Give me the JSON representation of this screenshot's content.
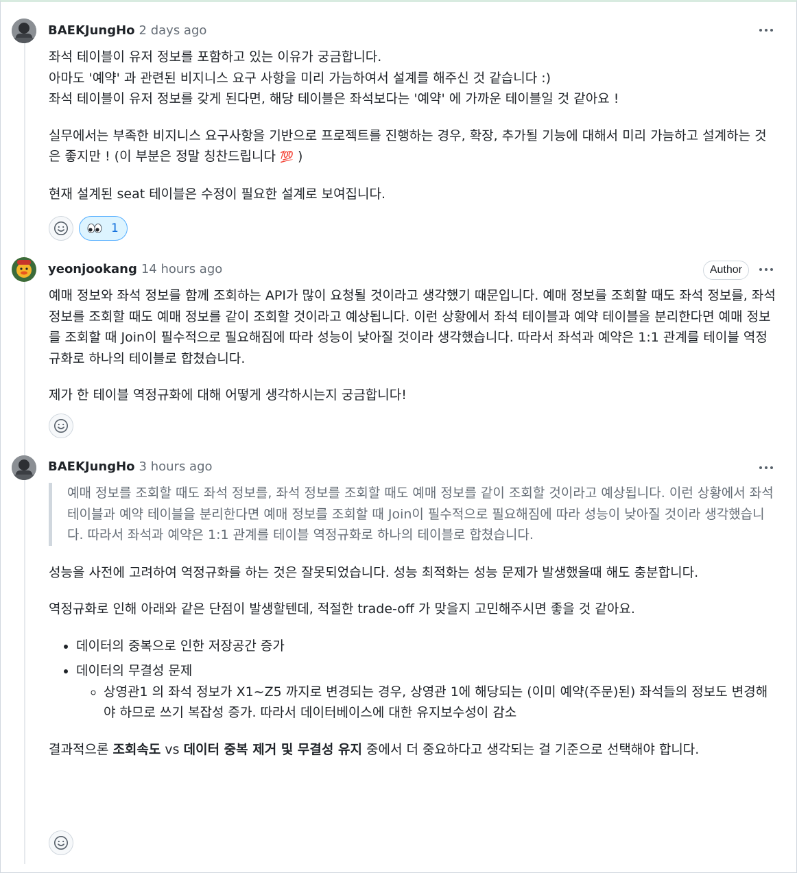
{
  "comments": [
    {
      "author": "BAEKJungHo",
      "time": "2 days ago",
      "p1_l1": "좌석 테이블이 유저 정보를 포함하고 있는 이유가 궁금합니다.",
      "p1_l2": "아마도 '예약' 과 관련된 비지니스 요구 사항을 미리 가늠하여서 설계를 해주신 것 같습니다 :)",
      "p1_l3": "좌석 테이블이 유저 정보를 갖게 된다면, 해당 테이블은 좌석보다는 '예약' 에 가까운 테이블일 것 같아요 !",
      "p2": "실무에서는 부족한 비지니스 요구사항을 기반으로 프로젝트를 진행하는 경우, 확장, 추가될 기능에 대해서 미리 가늠하고 설계하는 것은 좋지만 ! (이 부분은 정말 칭찬드립니다",
      "p2_emoji": "💯",
      "p2_end": ")",
      "p3": "현재 설계된 seat 테이블은 수정이 필요한 설계로 보여집니다.",
      "reaction_count": "1"
    },
    {
      "author": "yeonjookang",
      "time": "14 hours ago",
      "badge": "Author",
      "p1": "예매 정보와 좌석 정보를 함께 조회하는 API가 많이 요청될 것이라고 생각했기 때문입니다. 예매 정보를 조회할 때도 좌석 정보를, 좌석 정보를 조회할 때도 예매 정보를 같이 조회할 것이라고 예상됩니다. 이런 상황에서 좌석 테이블과 예약 테이블을 분리한다면 예매 정보를 조회할 때 Join이 필수적으로 필요해짐에 따라 성능이 낮아질 것이라 생각했습니다. 따라서 좌석과 예약은 1:1 관계를 테이블 역정규화로 하나의 테이블로 합쳤습니다.",
      "p2": "제가 한 테이블 역정규화에 대해 어떻게 생각하시는지 궁금합니다!"
    },
    {
      "author": "BAEKJungHo",
      "time": "3 hours ago",
      "quote": "예매 정보를 조회할 때도 좌석 정보를, 좌석 정보를 조회할 때도 예매 정보를 같이 조회할 것이라고 예상됩니다. 이런 상황에서 좌석 테이블과 예약 테이블을 분리한다면 예매 정보를 조회할 때 Join이 필수적으로 필요해짐에 따라 성능이 낮아질 것이라 생각했습니다. 따라서 좌석과 예약은 1:1 관계를 테이블 역정규화로 하나의 테이블로 합쳤습니다.",
      "p1": "성능을 사전에 고려하여 역정규화를 하는 것은 잘못되었습니다. 성능 최적화는 성능 문제가 발생했을때 해도 충분합니다.",
      "p2": "역정규화로 인해 아래와 같은 단점이 발생할텐데, 적절한 trade-off 가 맞을지 고민해주시면 좋을 것 같아요.",
      "bullet1": "데이터의 중복으로 인한 저장공간 증가",
      "bullet2": "데이터의 무결성 문제",
      "sub_bullet": "상영관1 의 좌석 정보가 X1~Z5 까지로 변경되는 경우, 상영관 1에 해당되는 (이미 예약(주문)된) 좌석들의 정보도 변경해야 하므로 쓰기 복잡성 증가. 따라서 데이터베이스에 대한 유지보수성이 감소",
      "p3_start": "결과적으론",
      "p3_bold1": "조회속도",
      "p3_vs": "vs",
      "p3_bold2": "데이터 중복 제거 및 무결성 유지",
      "p3_end": "중에서 더 중요하다고 생각되는 걸 기준으로 선택해야 합니다."
    }
  ],
  "icons": {
    "add_reaction": "smiley-icon",
    "more": "kebab-horizontal-icon",
    "reaction": "eyes-icon"
  },
  "colors": {
    "link_blue": "#0969da",
    "muted": "#656d76",
    "reaction_bg": "#ddf4ff"
  }
}
